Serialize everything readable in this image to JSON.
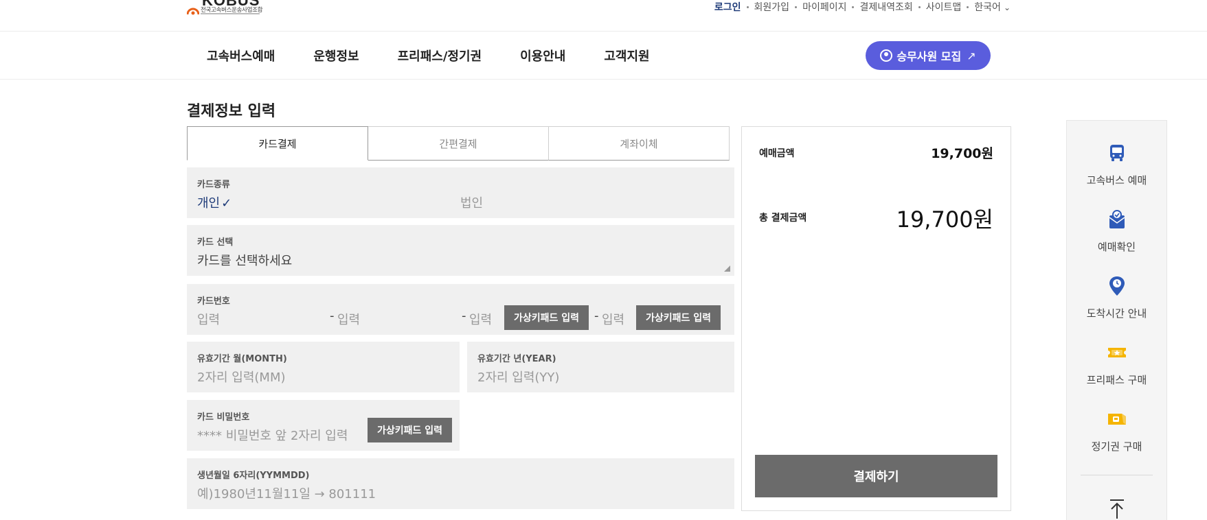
{
  "header": {
    "logo_text": "KOBUS",
    "logo_sub": "전국고속버스운송사업조합",
    "utility": {
      "login": "로그인",
      "join": "회원가입",
      "mypage": "마이페이지",
      "payment_history": "결제내역조회",
      "sitemap": "사이트맵",
      "language": "한국어"
    }
  },
  "nav": {
    "items": [
      "고속버스예매",
      "운행정보",
      "프리패스/정기권",
      "이용안내",
      "고객지원"
    ],
    "recruit_label": "승무사원 모집"
  },
  "page": {
    "title": "결제정보 입력"
  },
  "tabs": [
    "카드결제",
    "간편결제",
    "계좌이체"
  ],
  "form": {
    "card_kind": {
      "label": "카드종류",
      "personal": "개인",
      "corporate": "법인"
    },
    "card_select": {
      "label": "카드 선택",
      "placeholder": "카드를 선택하세요"
    },
    "card_number": {
      "label": "카드번호",
      "placeholder": "입력",
      "keypad_label": "가상키패드 입력"
    },
    "expiry_month": {
      "label": "유효기간 월(MONTH)",
      "placeholder": "2자리 입력(MM)"
    },
    "expiry_year": {
      "label": "유효기간 년(YEAR)",
      "placeholder": "2자리 입력(YY)"
    },
    "password": {
      "label": "카드 비밀번호",
      "placeholder": "**** 비밀번호 앞 2자리 입력",
      "keypad_label": "가상키패드 입력"
    },
    "birth": {
      "label": "생년월일 6자리(YYMMDD)",
      "placeholder": "예)1980년11월11일 → 801111"
    }
  },
  "summary": {
    "reserve_amount_label": "예매금액",
    "reserve_amount": "19,700원",
    "total_label": "총 결제금액",
    "total_amount": "19,700원",
    "pay_button": "결제하기"
  },
  "quick_menu": {
    "items": [
      "고속버스 예매",
      "예매확인",
      "도착시간 안내",
      "프리패스 구매",
      "정기권 구매"
    ]
  },
  "colors": {
    "brand_navy": "#1d3a78",
    "recruit_purple": "#5a5ddd",
    "icon_blue": "#2f5bb8",
    "icon_yellow": "#f5b400",
    "button_gray": "#6b6b6b"
  }
}
